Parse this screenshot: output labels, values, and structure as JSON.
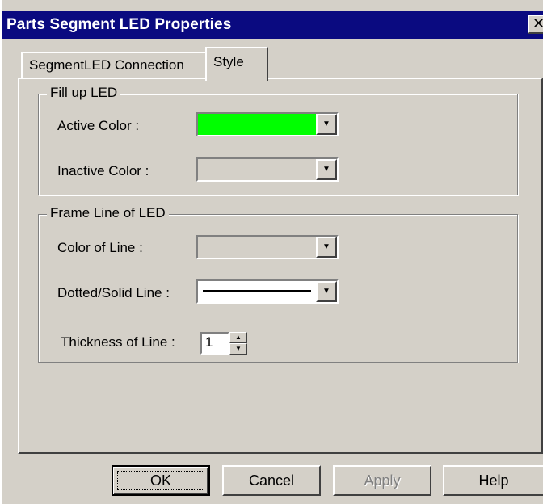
{
  "window": {
    "title": "Parts Segment LED Properties",
    "close_glyph": "✕"
  },
  "tabs": [
    {
      "label": "SegmentLED Connection",
      "active": false
    },
    {
      "label": "Style",
      "active": true
    }
  ],
  "fill_up": {
    "legend": "Fill up LED",
    "active_label": "Active Color :",
    "active_color": "#00ff00",
    "inactive_label": "Inactive Color :",
    "inactive_color": "#d4d0c8"
  },
  "frame_line": {
    "legend": "Frame Line of LED",
    "color_label": "Color of Line :",
    "line_color": "#d4d0c8",
    "style_label": "Dotted/Solid Line :",
    "style_value": "solid",
    "thickness_label": "Thickness of Line :",
    "thickness_value": "1"
  },
  "buttons": {
    "ok": "OK",
    "cancel": "Cancel",
    "apply": "Apply",
    "help": "Help"
  },
  "icons": {
    "dropdown": "chevron-down-icon",
    "spin_up": "spin-up-icon",
    "spin_down": "spin-down-icon"
  }
}
